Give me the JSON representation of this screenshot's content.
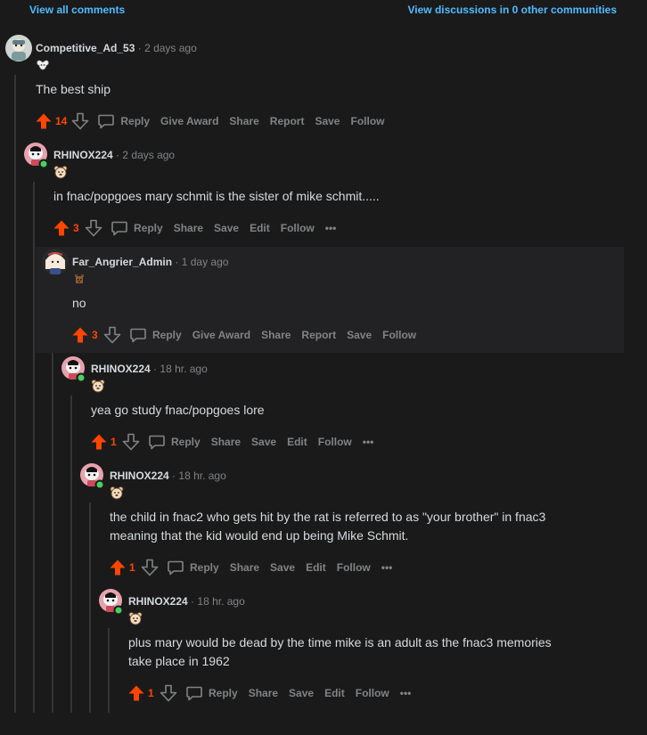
{
  "top": {
    "view_all": "View all comments",
    "view_discussions": "View discussions in 0 other communities"
  },
  "colors": {
    "upvote": "#ff4500",
    "link": "#4fbcff",
    "online": "#46d160"
  },
  "labels": {
    "reply": "Reply",
    "give_award": "Give Award",
    "share": "Share",
    "report": "Report",
    "save": "Save",
    "edit": "Edit",
    "follow": "Follow",
    "dot": "·",
    "more": "•••"
  },
  "comments": [
    {
      "user": "Competitive_Ad_53",
      "time": "2 days ago",
      "body": [
        "The best ship"
      ],
      "score": "14",
      "flair_icon": "ram-skull-icon"
    },
    {
      "user": "RHINOX224",
      "time": "2 days ago",
      "body": [
        "in fnac/popgoes mary schmit is the sister of mike schmit....."
      ],
      "score": "3",
      "flair_icon": "bear-face-icon"
    },
    {
      "user": "Far_Angrier_Admin",
      "time": "1 day ago",
      "body": [
        "no"
      ],
      "score": "3",
      "flair_icon": "bear-pixel-icon"
    },
    {
      "user": "RHINOX224",
      "time": "18 hr. ago",
      "body": [
        "yea go study fnac/popgoes lore"
      ],
      "score": "1",
      "flair_icon": "bear-face-icon"
    },
    {
      "user": "RHINOX224",
      "time": "18 hr. ago",
      "body": [
        "the child in fnac2 who gets hit by the rat is referred to as \"your brother\" in fnac3",
        "meaning that the kid would end up being Mike Schmit."
      ],
      "score": "1",
      "flair_icon": "bear-face-icon"
    },
    {
      "user": "RHINOX224",
      "time": "18 hr. ago",
      "body": [
        "plus mary would be dead by the time mike is an adult as the fnac3 memories",
        "take place in 1962"
      ],
      "score": "1",
      "flair_icon": "bear-face-icon"
    }
  ]
}
